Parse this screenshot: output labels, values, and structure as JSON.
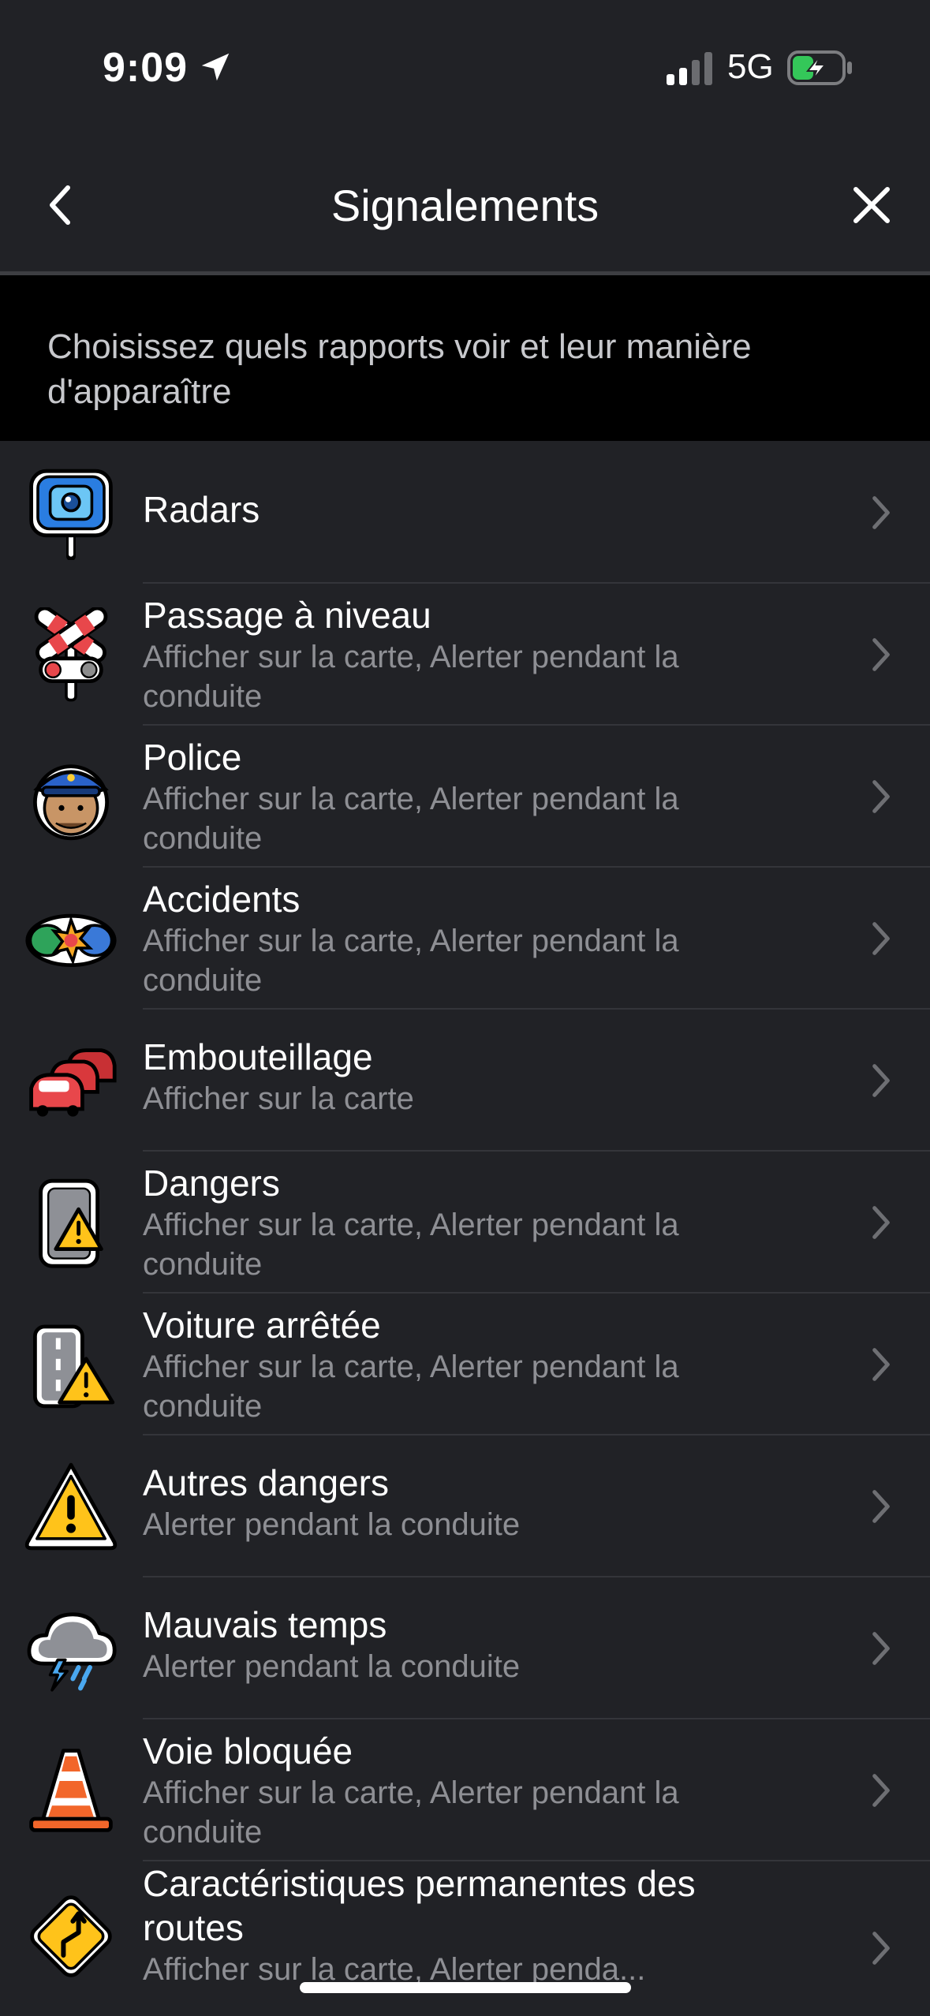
{
  "status_bar": {
    "time": "9:09",
    "network": "5G",
    "battery_charging": true,
    "accent_color": "#34c759"
  },
  "header": {
    "title": "Signalements",
    "back_icon": "chevron-left-icon",
    "close_icon": "close-icon"
  },
  "description": "Choisissez quels rapports voir et leur manière d'apparaître",
  "reports": [
    {
      "title": "Radars",
      "subtitle": "",
      "icon": "speed-camera-icon"
    },
    {
      "title": "Passage à niveau",
      "subtitle": "Afficher sur la carte, Alerter pendant la conduite",
      "icon": "railroad-crossing-icon"
    },
    {
      "title": "Police",
      "subtitle": "Afficher sur la carte, Alerter pendant la conduite",
      "icon": "police-icon"
    },
    {
      "title": "Accidents",
      "subtitle": "Afficher sur la carte, Alerter pendant la conduite",
      "icon": "accident-icon"
    },
    {
      "title": "Embouteillage",
      "subtitle": "Afficher sur la carte",
      "icon": "traffic-jam-icon"
    },
    {
      "title": "Dangers",
      "subtitle": "Afficher sur la carte, Alerter pendant la conduite",
      "icon": "road-hazard-icon"
    },
    {
      "title": "Voiture arrêtée",
      "subtitle": "Afficher sur la carte, Alerter pendant la conduite",
      "icon": "stopped-car-icon"
    },
    {
      "title": "Autres dangers",
      "subtitle": "Alerter pendant la conduite",
      "icon": "warning-icon"
    },
    {
      "title": "Mauvais temps",
      "subtitle": "Alerter pendant la conduite",
      "icon": "storm-cloud-icon"
    },
    {
      "title": "Voie bloquée",
      "subtitle": "Afficher sur la carte, Alerter pendant la conduite",
      "icon": "traffic-cone-icon"
    },
    {
      "title": "Caractéristiques permanentes des routes",
      "subtitle": "Afficher sur la carte, Alerter penda...",
      "icon": "winding-road-sign-icon"
    }
  ]
}
